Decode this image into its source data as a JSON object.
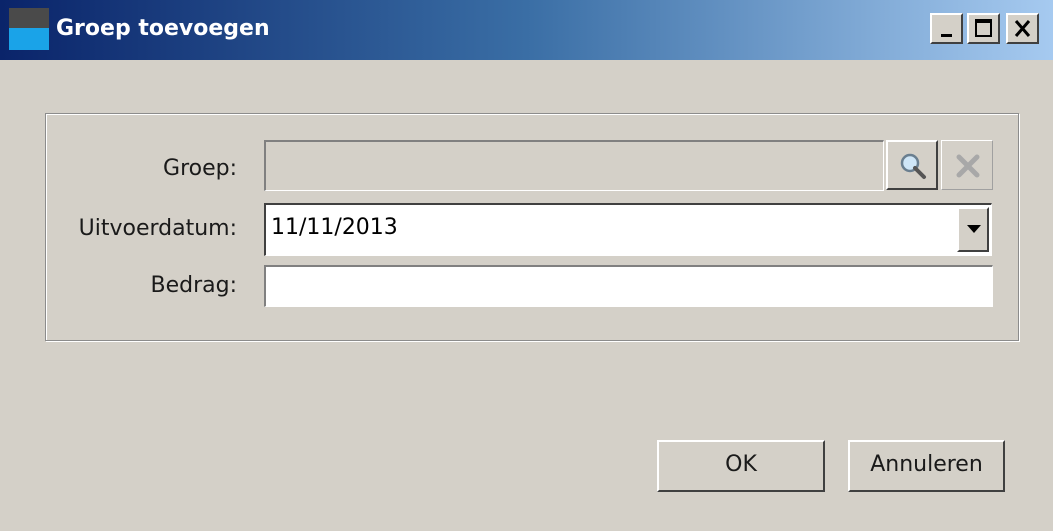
{
  "window": {
    "title": "Groep toevoegen",
    "controls": [
      "minimize-icon",
      "maximize-icon",
      "close-icon"
    ]
  },
  "form": {
    "groep": {
      "label": "Groep:",
      "value": ""
    },
    "uitvoerdatum": {
      "label": "Uitvoerdatum:",
      "value": "11/11/2013"
    },
    "bedrag": {
      "label": "Bedrag:",
      "value": ""
    }
  },
  "buttons": {
    "ok": "OK",
    "cancel": "Annuleren"
  },
  "colors": {
    "titlebar_start": "#0a246a",
    "titlebar_end": "#a6caf0",
    "dialog_bg": "#d4d0c8"
  }
}
